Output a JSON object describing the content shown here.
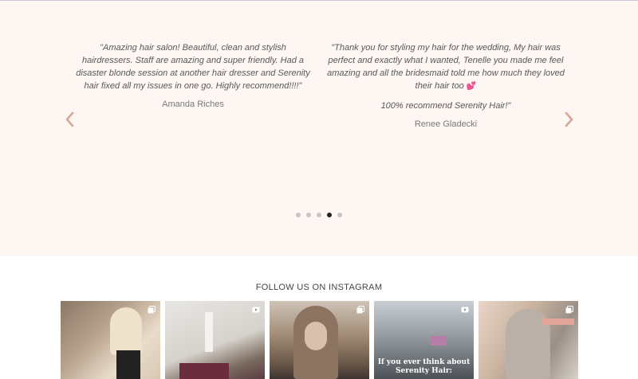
{
  "testimonials": [
    {
      "quote": "\"Amazing hair salon! Beautiful, clean and stylish hairdressers. Staff are amazing and super friendly. Had a disaster blonde session at another hair dresser and Serenity hair fixed all my issues in one go. Highly recommend!!!!\"",
      "author": "Amanda Riches"
    },
    {
      "quote": "\"Thank you for styling my hair for the wedding, My hair was perfect and exactly what I wanted, Tenelle you made me feel amazing and all the bridesmaid told me how much they loved their hair too",
      "quote_emoji": "💕",
      "quote_continued": "100% recommend Serenity Hair!\"",
      "author": "Renee Gladecki"
    }
  ],
  "carousel": {
    "prev_icon": "chevron-left-icon",
    "next_icon": "chevron-right-icon",
    "dot_count": 5,
    "active_dot": 4
  },
  "instagram": {
    "heading": "FOLLOW US ON INSTAGRAM",
    "posts": [
      {
        "type": "carousel",
        "icon": "gallery-icon"
      },
      {
        "type": "video",
        "icon": "video-icon"
      },
      {
        "type": "carousel",
        "icon": "gallery-icon"
      },
      {
        "type": "video",
        "icon": "video-icon",
        "overlay_text": "If you ever think about Serenity Hair:"
      },
      {
        "type": "carousel",
        "icon": "gallery-icon"
      }
    ]
  },
  "colors": {
    "testimonial_bg": "#fdf6f2",
    "arrow": "#d9a595",
    "dot": "#c9c4c2",
    "dot_active": "#222222"
  }
}
